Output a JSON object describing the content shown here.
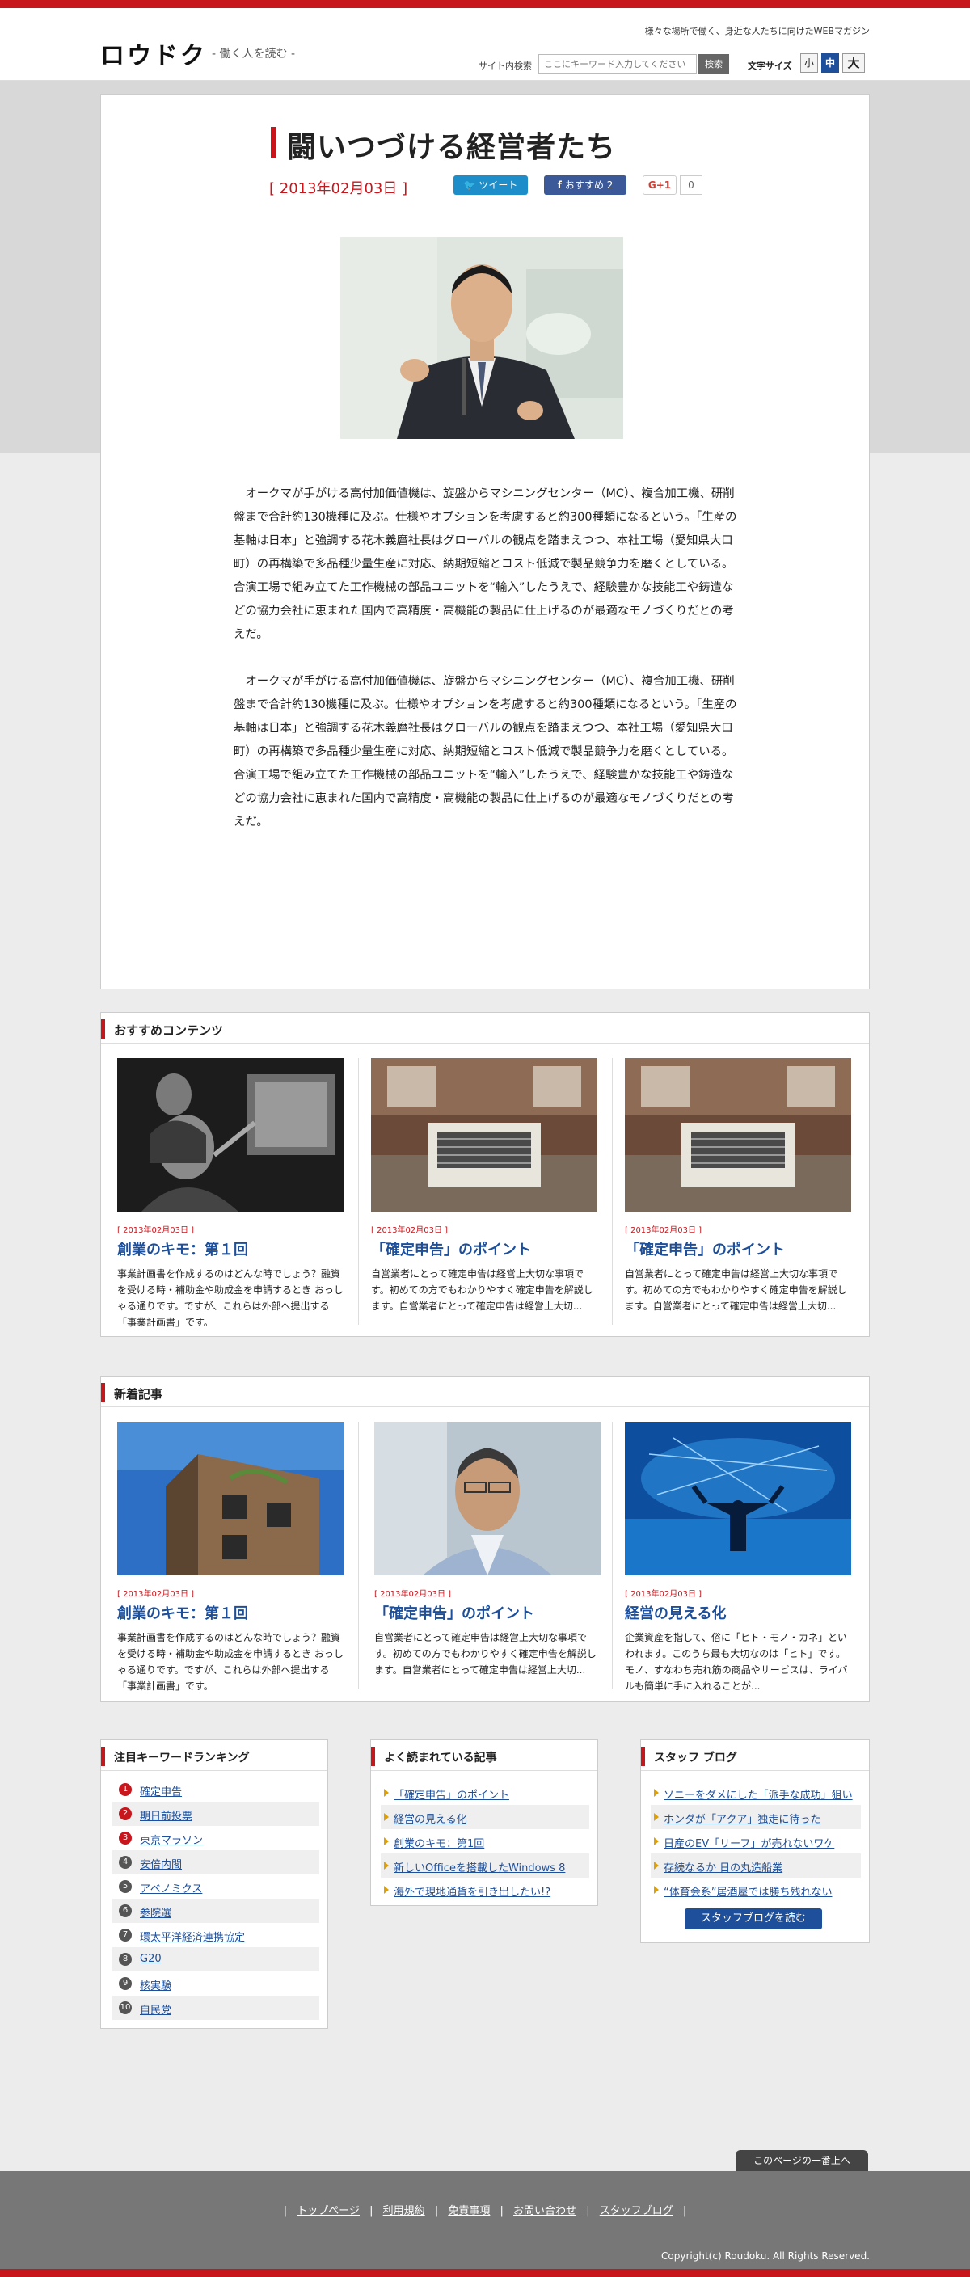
{
  "header": {
    "logo": "ロウドク",
    "logo_sub": "- 働く人を読む -",
    "tagline": "様々な場所で働く、身近な人たちに向けたWEBマガジン",
    "search_label": "サイト内検索",
    "search_placeholder": "ここにキーワード入力してください",
    "search_button": "検索",
    "font_size_label": "文字サイズ",
    "font_sizes": [
      "小",
      "中",
      "大"
    ]
  },
  "article": {
    "title": "闘いつづける経営者たち",
    "date": "[ 2013年02月03日 ]",
    "tweet": "ツイート",
    "fb": "おすすめ 2",
    "gplus": "G+1",
    "gplus_count": "0",
    "paragraphs": [
      "オークマが手がける高付加価値機は、旋盤からマシニングセンター（MC）、複合加工機、研削盤まで合計約130機種に及ぶ。仕様やオプションを考慮すると約300種類になるという。「生産の基軸は日本」と強調する花木義麿社長はグローバルの観点を踏まえつつ、本社工場（愛知県大口町）の再構築で多品種少量生産に対応、納期短縮とコスト低減で製品競争力を磨くとしている。合演工場で組み立てた工作機械の部品ユニットを“輸入”したうえで、経験豊かな技能工や鋳造などの協力会社に恵まれた国内で高精度・高機能の製品に仕上げるのが最適なモノづくりだとの考えだ。",
      "オークマが手がける高付加価値機は、旋盤からマシニングセンター（MC）、複合加工機、研削盤まで合計約130機種に及ぶ。仕様やオプションを考慮すると約300種類になるという。「生産の基軸は日本」と強調する花木義麿社長はグローバルの観点を踏まえつつ、本社工場（愛知県大口町）の再構築で多品種少量生産に対応、納期短縮とコスト低減で製品競争力を磨くとしている。合演工場で組み立てた工作機械の部品ユニットを“輸入”したうえで、経験豊かな技能工や鋳造などの協力会社に恵まれた国内で高精度・高機能の製品に仕上げるのが最適なモノづくりだとの考えだ。"
    ]
  },
  "osusume": {
    "heading": "おすすめコンテンツ",
    "cards": [
      {
        "date": "[ 2013年02月03日 ]",
        "title": "創業のキモ：第１回",
        "desc": "事業計画書を作成するのはどんな時でしょう？融資を受ける時・補助金や助成金を申請するとき おっしゃる通りです。ですが、これらは外部へ提出する「事業計画書」です。"
      },
      {
        "date": "[ 2013年02月03日 ]",
        "title": "「確定申告」のポイント",
        "desc": "自営業者にとって確定申告は経営上大切な事項です。初めての方でもわかりやすく確定申告を解説します。自営業者にとって確定申告は経営上大切..."
      },
      {
        "date": "[ 2013年02月03日 ]",
        "title": "「確定申告」のポイント",
        "desc": "自営業者にとって確定申告は経営上大切な事項です。初めての方でもわかりやすく確定申告を解説します。自営業者にとって確定申告は経営上大切..."
      }
    ]
  },
  "shinchaku": {
    "heading": "新着記事",
    "cards": [
      {
        "date": "[ 2013年02月03日 ]",
        "title": "創業のキモ：第１回",
        "desc": "事業計画書を作成するのはどんな時でしょう？融資を受ける時・補助金や助成金を申請するとき おっしゃる通りです。ですが、これらは外部へ提出する「事業計画書」です。"
      },
      {
        "date": "[ 2013年02月03日 ]",
        "title": "「確定申告」のポイント",
        "desc": "自営業者にとって確定申告は経営上大切な事項です。初めての方でもわかりやすく確定申告を解説します。自営業者にとって確定申告は経営上大切..."
      },
      {
        "date": "[ 2013年02月03日 ]",
        "title": "経営の見える化",
        "desc": "企業資産を指して、俗に「ヒト・モノ・カネ」といわれます。このうち最も大切なのは「ヒト」です。モノ、すなわち売れ筋の商品やサービスは、ライバルも簡単に手に入れることが..."
      }
    ]
  },
  "ranking": {
    "heading": "注目キーワードランキング",
    "items": [
      {
        "num": "1",
        "label": "確定申告"
      },
      {
        "num": "2",
        "label": "期日前投票"
      },
      {
        "num": "3",
        "label": "東京マラソン"
      },
      {
        "num": "4",
        "label": "安倍内閣"
      },
      {
        "num": "5",
        "label": "アベノミクス"
      },
      {
        "num": "6",
        "label": "参院選"
      },
      {
        "num": "7",
        "label": "環太平洋経済連携協定"
      },
      {
        "num": "8",
        "label": "G20"
      },
      {
        "num": "9",
        "label": "核実験"
      },
      {
        "num": "10",
        "label": "自民党"
      }
    ]
  },
  "popular": {
    "heading": "よく読まれている記事",
    "items": [
      "「確定申告」のポイント",
      "経営の見える化",
      "創業のキモ：第1回",
      "新しいOfficeを搭載したWindows 8",
      "海外で現地通貨を引き出したい!?"
    ]
  },
  "staff_blog": {
    "heading": "スタッフ ブログ",
    "items": [
      "ソニーをダメにした「派手な成功」狙い",
      "ホンダが「アクア」独走に待った",
      "日産のEV「リーフ」が売れないワケ",
      "存続なるか 日の丸造船業",
      "“体育会系”居酒屋では勝ち残れない"
    ],
    "button": "スタッフブログを読む"
  },
  "footer": {
    "pagetop": "このページの一番上へ",
    "nav": [
      "トップページ",
      "利用規約",
      "免責事項",
      "お問い合わせ",
      "スタッフブログ"
    ],
    "copyright": "Copyright(c) Roudoku. All Rights Reserved."
  }
}
